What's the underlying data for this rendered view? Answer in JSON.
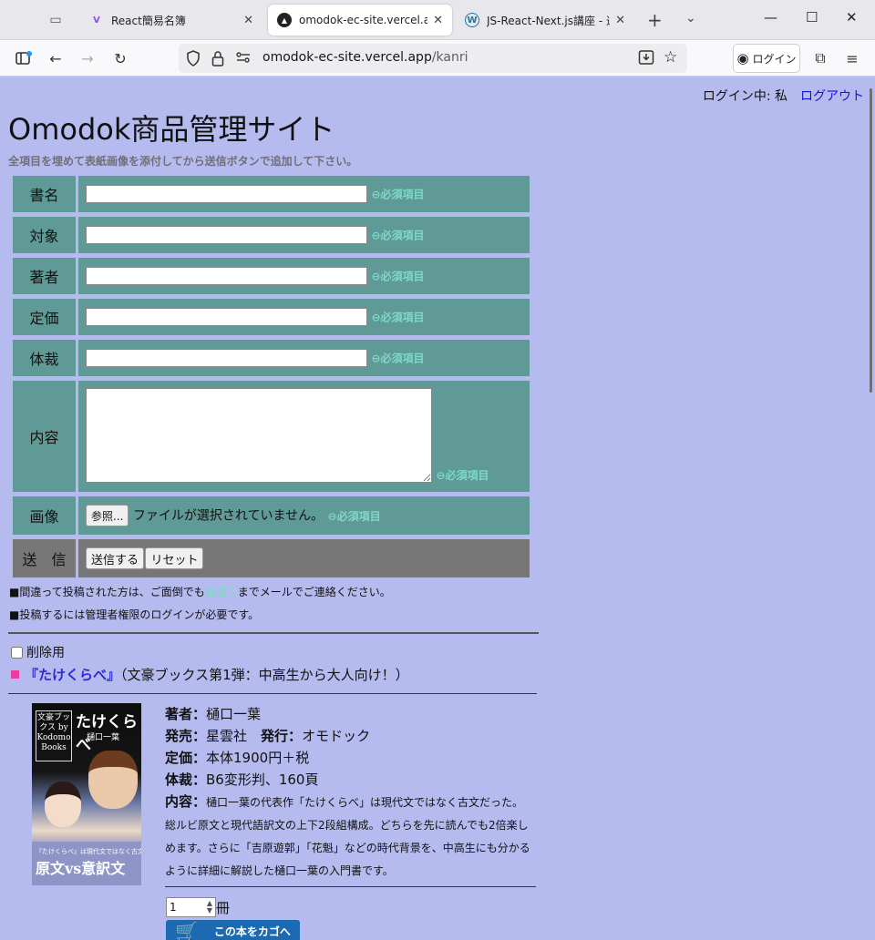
{
  "browser": {
    "tabs": [
      {
        "title": "React簡易名簿",
        "favicon": "V"
      },
      {
        "title": "omodok-ec-site.vercel.app/k",
        "favicon": "▲"
      },
      {
        "title": "JS-React-Next.js講座 - 通学",
        "favicon": "W"
      }
    ],
    "url_host": "omodok-ec-site.vercel.app",
    "url_path": "/kanri",
    "login_label": "ログイン"
  },
  "page": {
    "login_status": "ログイン中: 私",
    "logout_label": "ログアウト",
    "title": "Omodok商品管理サイト",
    "intro": "全項目を埋めて表紙画像を添付してから送信ボタンで追加して下さい。",
    "required_label": "⊖必須項目",
    "form": {
      "title_label": "書名",
      "target_label": "対象",
      "author_label": "著者",
      "price_label": "定価",
      "format_label": "体裁",
      "content_label": "内容",
      "image_label": "画像",
      "browse_label": "参照...",
      "no_file": "ファイルが選択されていません。",
      "send_label": "送　信",
      "submit_label": "送信する",
      "reset_label": "リセット"
    },
    "note1_pre": "■間違って投稿された方は、ご面倒でも",
    "note1_link": "管理人",
    "note1_post": "までメールでご連絡ください。",
    "note2": "■投稿するには管理者権限のログインが必要です。",
    "delete_label": "削除用",
    "book": {
      "name": "『たけくらべ』",
      "subtitle": "（文豪ブックス第1弾：中高生から大人向け！）",
      "author_label": "著者：",
      "author": "樋口一葉",
      "seller_label": "発売：",
      "seller": "星雲社",
      "publisher_label": "発行：",
      "publisher": "オモドック",
      "price_label": "定価：",
      "price": "本体1900円＋税",
      "format_label": "体裁：",
      "format": "B6変形判、160頁",
      "content_label": "内容：",
      "content": "樋口一葉の代表作「たけくらべ」は現代文ではなく古文だった。総ルビ原文と現代語訳文の上下2段組構成。どちらを先に読んでも2倍楽しめます。さらに「吉原遊郭」「花魁」などの時代背景を、中高生にも分かるように詳細に解説した樋口一葉の入門書です。",
      "cover_brand": "文豪ブックス by Kodomo Books",
      "cover_title": "たけくらべ",
      "cover_author": "樋口一葉",
      "cover_band_small": "『たけくらべ』は現代文ではなく古文だった?!",
      "cover_band_large": "原文vs意訳文",
      "qty_value": "1",
      "qty_unit": "冊",
      "cart_label": "この本をカゴへ"
    }
  }
}
